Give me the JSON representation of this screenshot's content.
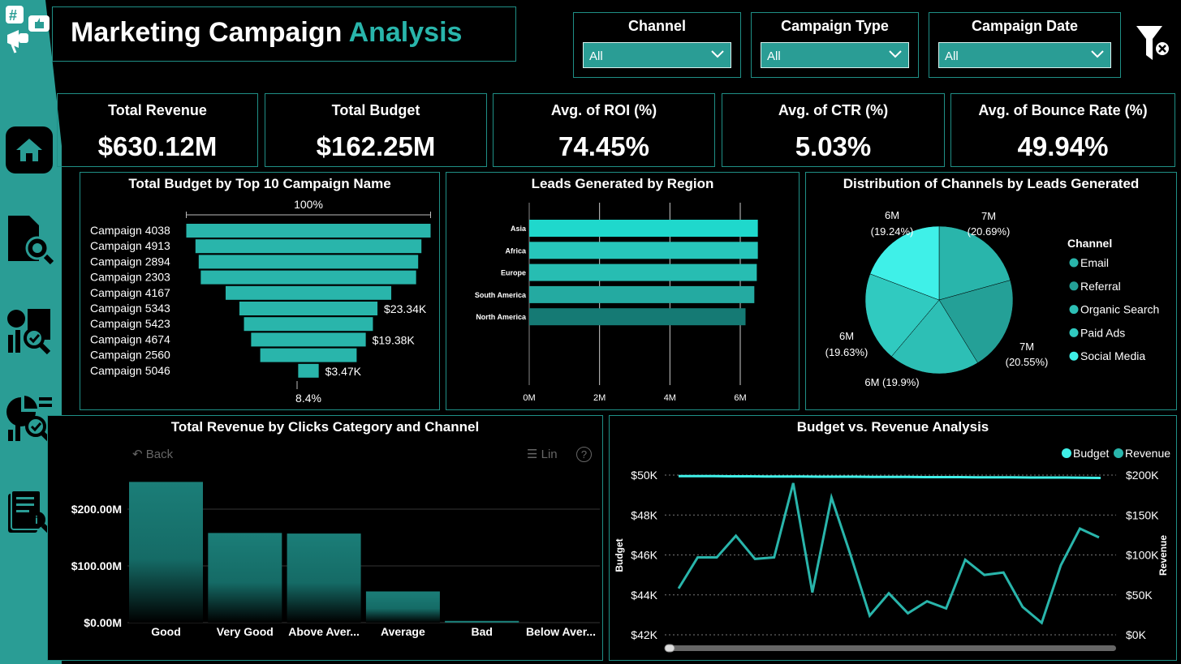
{
  "header": {
    "title_main": "Marketing Campaign",
    "title_accent": "Analysis"
  },
  "slicers": [
    {
      "label": "Channel",
      "value": "All"
    },
    {
      "label": "Campaign Type",
      "value": "All"
    },
    {
      "label": "Campaign Date",
      "value": "All"
    }
  ],
  "kpis": [
    {
      "label": "Total Revenue",
      "value": "$630.12M"
    },
    {
      "label": "Total Budget",
      "value": "$162.25M"
    },
    {
      "label": "Avg. of ROI (%)",
      "value": "74.45%"
    },
    {
      "label": "Avg. of CTR (%)",
      "value": "5.03%"
    },
    {
      "label": "Avg. of Bounce Rate (%)",
      "value": "49.94%"
    }
  ],
  "colors": {
    "accent": "#29b5ab",
    "border": "#1f8f86",
    "sidebar": "#2a9d95",
    "bright": "#3ff0e8"
  },
  "toolbar": {
    "back_label": "Back",
    "lin_label": "Lin"
  },
  "chart_data": [
    {
      "type": "funnel",
      "title": "Total Budget by Top 10 Campaign Name",
      "categories": [
        "Campaign 4038",
        "Campaign 4913",
        "Campaign 2894",
        "Campaign 2303",
        "Campaign 4167",
        "Campaign 5343",
        "Campaign 5423",
        "Campaign 4674",
        "Campaign 2560",
        "Campaign 5046"
      ],
      "values": [
        41.3,
        38.2,
        37.1,
        36.4,
        28.0,
        23.34,
        21.8,
        19.38,
        16.3,
        3.47
      ],
      "labels": {
        "top": "100%",
        "bottom": "8.4%",
        "Campaign 5343": "$23.34K",
        "Campaign 4674": "$19.38K",
        "Campaign 5046": "$3.47K"
      }
    },
    {
      "type": "bar",
      "orientation": "horizontal",
      "title": "Leads Generated by Region",
      "categories": [
        "Asia",
        "Africa",
        "Europe",
        "South America",
        "North America"
      ],
      "values": [
        6.5,
        6.5,
        6.47,
        6.4,
        6.15
      ],
      "xlim": [
        0,
        6.5
      ],
      "xticks": [
        "0M",
        "2M",
        "4M",
        "6M"
      ]
    },
    {
      "type": "pie",
      "title": "Distribution of Channels by Leads Generated",
      "legend_title": "Channel",
      "series": [
        {
          "name": "Email",
          "value": 7,
          "label": "7M",
          "pct": "(20.69%)"
        },
        {
          "name": "Referral",
          "value": 7,
          "label": "7M",
          "pct": "(20.55%)"
        },
        {
          "name": "Organic Search",
          "value": 6,
          "label": "6M (19.9%)",
          "pct": ""
        },
        {
          "name": "Paid Ads",
          "value": 6,
          "label": "6M",
          "pct": "(19.63%)"
        },
        {
          "name": "Social Media",
          "value": 6,
          "label": "6M",
          "pct": "(19.24%)"
        }
      ],
      "percents": [
        20.69,
        20.55,
        19.9,
        19.63,
        19.24
      ]
    },
    {
      "type": "bar",
      "title": "Total Revenue by Clicks Category and Channel",
      "categories": [
        "Good",
        "Very Good",
        "Above Aver...",
        "Average",
        "Bad",
        "Below Aver..."
      ],
      "values": [
        248,
        158,
        157,
        55,
        3,
        0
      ],
      "ylim": [
        0,
        250
      ],
      "yticks": [
        "$0.00M",
        "$100.00M",
        "$200.00M"
      ]
    },
    {
      "type": "line",
      "title": "Budget vs. Revenue Analysis",
      "legend": [
        "Budget",
        "Revenue"
      ],
      "ylabel_left": "Budget",
      "ylabel_right": "Revenue",
      "yticks_left": [
        "$42K",
        "$44K",
        "$46K",
        "$48K",
        "$50K"
      ],
      "yticks_right": [
        "$0K",
        "$50K",
        "$100K",
        "$150K",
        "$200K"
      ],
      "budget": [
        49.95,
        49.95,
        49.95,
        49.94,
        49.94,
        49.93,
        49.93,
        49.93,
        49.92,
        49.92,
        49.92,
        49.91,
        49.91,
        49.91,
        49.9,
        49.9,
        49.9,
        49.89,
        49.89,
        49.89,
        49.88,
        49.88,
        49.88,
        49.87,
        49.86
      ],
      "revenue": [
        58,
        97,
        97,
        124,
        95,
        97,
        190,
        53,
        172,
        100,
        24,
        52,
        27,
        42,
        33,
        94,
        75,
        78,
        35,
        15,
        87,
        133,
        122
      ]
    }
  ]
}
